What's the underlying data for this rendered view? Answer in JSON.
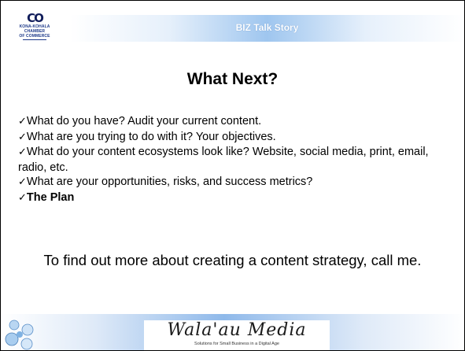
{
  "header": {
    "title": "BIZ Talk Story",
    "logo": {
      "mark": "CO",
      "lines": [
        "KONA-KOHALA",
        "CHAMBER",
        "OF COMMERCE"
      ]
    }
  },
  "slide": {
    "title": "What Next?",
    "bullets": [
      {
        "check": "✓",
        "text": "What do you have? Audit your current content."
      },
      {
        "check": "✓",
        "text": "What are you trying to do with it? Your objectives."
      },
      {
        "check": "✓",
        "text": "What do your content ecosystems look like? Website, social media, print, email, radio, etc."
      },
      {
        "check": "✓",
        "text": "What are your opportunities, risks, and success metrics?"
      },
      {
        "check": "✓",
        "text": "The Plan",
        "bold": true
      }
    ],
    "cta": "To find out more about creating a content strategy, call me."
  },
  "footer": {
    "brand_name": "Wala'au Media",
    "brand_tagline": "Solutions for Small Business in a Digital Age"
  },
  "colors": {
    "header_blue": "#9fc6ef",
    "logo_navy": "#101c5a",
    "footer_blue": "#8fb9ea"
  }
}
